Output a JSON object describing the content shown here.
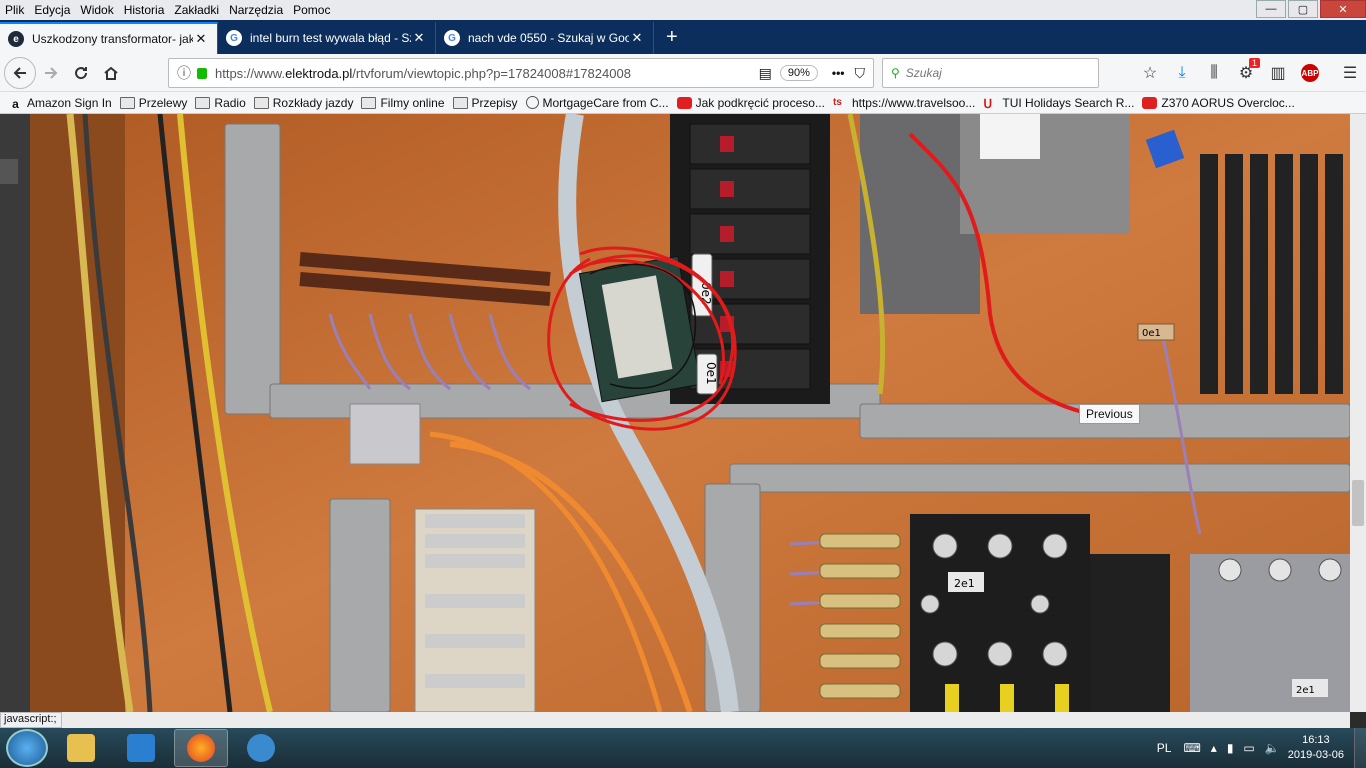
{
  "menu": [
    "Plik",
    "Edycja",
    "Widok",
    "Historia",
    "Zakładki",
    "Narzędzia",
    "Pomoc"
  ],
  "window_controls": {
    "minimize": "—",
    "maximize": "▢",
    "close": "✕"
  },
  "tabs": [
    {
      "title": "Uszkodzony transformator- jak",
      "favicon": "e",
      "favicon_color": "#1f2b3a"
    },
    {
      "title": "intel burn test wywala błąd - Sz",
      "favicon": "G",
      "favicon_color": "#4285f4"
    },
    {
      "title": "nach vde 0550 - Szukaj w Goog",
      "favicon": "G",
      "favicon_color": "#4285f4"
    }
  ],
  "new_tab": "+",
  "address": {
    "prefix": "https://www.",
    "domain": "elektroda.pl",
    "path": "/rtvforum/viewtopic.php?p=17824008#17824008"
  },
  "zoom": "90%",
  "page_actions": "•••",
  "search": {
    "placeholder": "Szukaj"
  },
  "notification_badge": "1",
  "abp": "ABP",
  "bookmarks": [
    {
      "label": "Amazon Sign In",
      "icon": "amazon"
    },
    {
      "label": "Przelewy",
      "icon": "folder"
    },
    {
      "label": "Radio",
      "icon": "folder"
    },
    {
      "label": "Rozkłady jazdy",
      "icon": "folder"
    },
    {
      "label": "Filmy online",
      "icon": "folder"
    },
    {
      "label": "Przepisy",
      "icon": "folder"
    },
    {
      "label": "MortgageCare from C...",
      "icon": "globe"
    },
    {
      "label": "Jak podkręcić proceso...",
      "icon": "youtube"
    },
    {
      "label": "https://www.travelsoo...",
      "icon": "ts"
    },
    {
      "label": "TUI Holidays Search R...",
      "icon": "tui"
    },
    {
      "label": "Z370 AORUS Overcloc...",
      "icon": "youtube"
    }
  ],
  "tooltip": "Previous",
  "status_text": "javascript:;",
  "photo_labels": {
    "rel1": "0e2",
    "rel2": "0e1",
    "label3": "2e1",
    "label4": "0e1",
    "label5": "2e1"
  },
  "taskbar": {
    "lang": "PL",
    "time": "16:13",
    "date": "2019-03-06"
  },
  "colors": {
    "tabbar": "#0c2e5c",
    "accent": "#0a84ff",
    "panel": "#c86a2e",
    "marker": "#e01b1b"
  }
}
